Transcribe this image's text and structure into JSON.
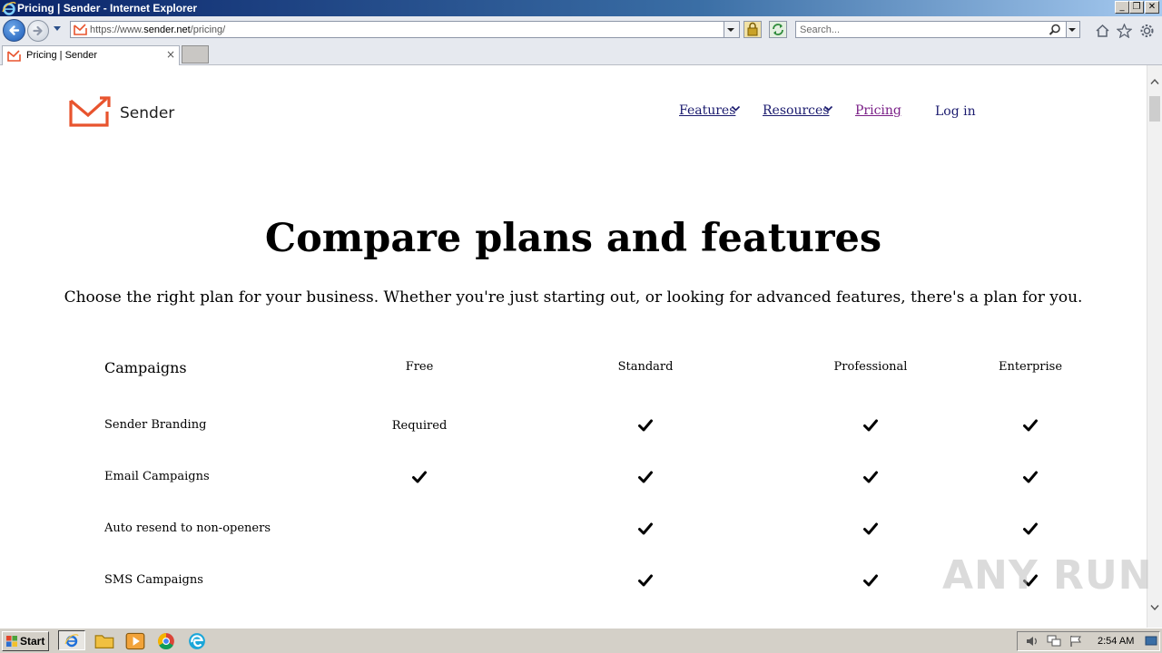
{
  "window": {
    "title": "Pricing | Sender - Internet Explorer",
    "minimize_label": "_",
    "restore_label": "❐",
    "close_label": "✕"
  },
  "browser": {
    "url_prefix": "https://www.",
    "url_host": "sender.net",
    "url_path": "/pricing/",
    "search_placeholder": "Search...",
    "tab_label": "Pricing | Sender",
    "tab_close": "×"
  },
  "site": {
    "logo_text": "Sender",
    "brand_color": "#e8542e",
    "nav": {
      "features": "Features",
      "resources": "Resources",
      "pricing": "Pricing",
      "login": "Log in"
    }
  },
  "main": {
    "heading": "Compare plans and features",
    "subheading": "Choose the right plan for your business. Whether you're just starting out, or looking for advanced features, there's a plan for you."
  },
  "table": {
    "section_title": "Campaigns",
    "plans": [
      "Free",
      "Standard",
      "Professional",
      "Enterprise"
    ],
    "rows": [
      {
        "feature": "Sender Branding",
        "free": "Required",
        "free_check": false,
        "standard": true,
        "professional": true,
        "enterprise": true
      },
      {
        "feature": "Email Campaigns",
        "free": "",
        "free_check": true,
        "standard": true,
        "professional": true,
        "enterprise": true
      },
      {
        "feature": "Auto resend to non-openers",
        "free": "",
        "free_check": false,
        "standard": true,
        "professional": true,
        "enterprise": true
      },
      {
        "feature": "SMS Campaigns",
        "free": "",
        "free_check": false,
        "standard": true,
        "professional": true,
        "enterprise": true
      }
    ]
  },
  "watermark": "ANY RUN",
  "taskbar": {
    "start_label": "Start",
    "clock": "2:54 AM"
  }
}
